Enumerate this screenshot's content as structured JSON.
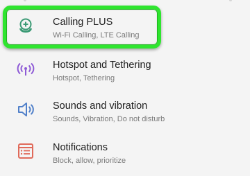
{
  "accent_color": "#2fe52f",
  "items": [
    {
      "title": "Calling PLUS",
      "subtitle": "Wi-Fi Calling, LTE Calling",
      "icon": "calling-plus-icon",
      "icon_color": "#3b9a75"
    },
    {
      "title": "Hotspot and Tethering",
      "subtitle": "Hotspot, Tethering",
      "icon": "hotspot-icon",
      "icon_color": "#8e5ad6"
    },
    {
      "title": "Sounds and vibration",
      "subtitle": "Sounds, Vibration, Do not disturb",
      "icon": "speaker-icon",
      "icon_color": "#4f7fc9"
    },
    {
      "title": "Notifications",
      "subtitle": "Block, allow, prioritize",
      "icon": "notifications-icon",
      "icon_color": "#e06a5a"
    }
  ]
}
